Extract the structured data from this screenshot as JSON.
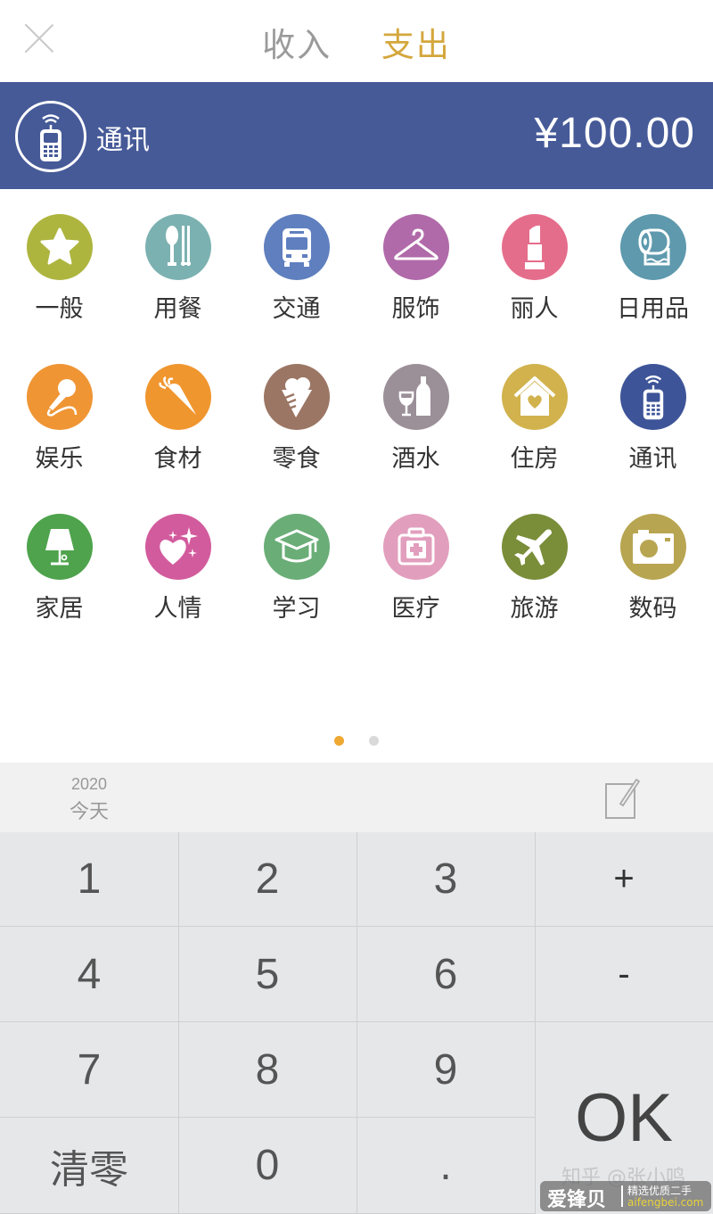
{
  "header": {
    "close_icon": "close-icon",
    "tabs": [
      {
        "label": "收入",
        "active": false
      },
      {
        "label": "支出",
        "active": true
      }
    ],
    "active_color": "#d4a73d",
    "inactive_color": "#9a9a9a"
  },
  "selected": {
    "icon": "mobile-phone-icon",
    "label": "通讯",
    "amount": "¥100.00",
    "color": "#465a98"
  },
  "categories": [
    {
      "label": "一般",
      "icon": "star-icon",
      "color": "#aeb53f"
    },
    {
      "label": "用餐",
      "icon": "spoon-chopsticks-icon",
      "color": "#7cb1b1"
    },
    {
      "label": "交通",
      "icon": "bus-icon",
      "color": "#5f7fbf"
    },
    {
      "label": "服饰",
      "icon": "hanger-icon",
      "color": "#b06aa9"
    },
    {
      "label": "丽人",
      "icon": "lipstick-icon",
      "color": "#e56d8c"
    },
    {
      "label": "日用品",
      "icon": "toilet-paper-icon",
      "color": "#5e99ad"
    },
    {
      "label": "娱乐",
      "icon": "microphone-icon",
      "color": "#ef9534"
    },
    {
      "label": "食材",
      "icon": "carrot-icon",
      "color": "#f0962f"
    },
    {
      "label": "零食",
      "icon": "ice-cream-icon",
      "color": "#9b7664"
    },
    {
      "label": "酒水",
      "icon": "wine-icon",
      "color": "#9b8f98"
    },
    {
      "label": "住房",
      "icon": "house-heart-icon",
      "color": "#d1b24d"
    },
    {
      "label": "通讯",
      "icon": "mobile-phone-icon",
      "color": "#3d5498"
    },
    {
      "label": "家居",
      "icon": "lamp-icon",
      "color": "#4ea34c"
    },
    {
      "label": "人情",
      "icon": "heart-sparkle-icon",
      "color": "#d25b9d"
    },
    {
      "label": "学习",
      "icon": "graduation-cap-icon",
      "color": "#6aad77"
    },
    {
      "label": "医疗",
      "icon": "medical-kit-icon",
      "color": "#e29ebd"
    },
    {
      "label": "旅游",
      "icon": "airplane-icon",
      "color": "#7a8d39"
    },
    {
      "label": "数码",
      "icon": "camera-icon",
      "color": "#b8a551"
    }
  ],
  "pager": {
    "pages": 2,
    "current": 1
  },
  "datebar": {
    "year": "2020",
    "day": "今天",
    "note_icon": "edit-note-icon"
  },
  "keypad": {
    "keys": [
      "1",
      "2",
      "3",
      "+",
      "4",
      "5",
      "6",
      "-",
      "7",
      "8",
      "9",
      "清零",
      "0",
      "."
    ],
    "ok": "OK"
  },
  "watermark": {
    "source": "知乎 @张小鸣",
    "brand": "爱锋贝",
    "tagline": "精选优质二手",
    "url": "aifengbei.com"
  }
}
